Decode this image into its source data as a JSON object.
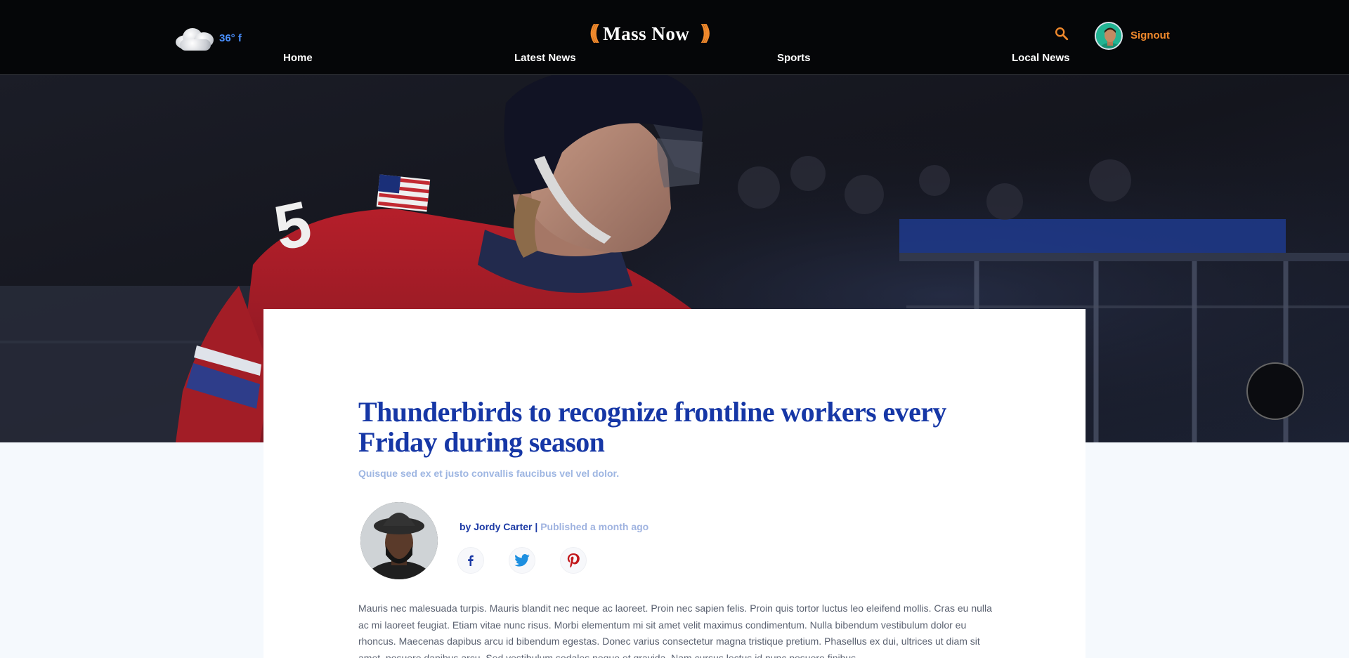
{
  "header": {
    "weather": {
      "icon": "cloud-icon",
      "temperature": "36° f"
    },
    "logo": {
      "text": "Mass Now",
      "left_waves": "(((",
      "right_waves": ")))"
    },
    "search": {
      "icon": "search-icon"
    },
    "user": {
      "avatar": "user-avatar",
      "signout_label": "Signout"
    },
    "nav": [
      {
        "label": "Home"
      },
      {
        "label": "Latest News"
      },
      {
        "label": "Sports"
      },
      {
        "label": "Local News"
      }
    ]
  },
  "hero": {
    "image": "hockey-player-photo"
  },
  "article": {
    "title": "Thunderbirds to recognize frontline workers every Friday during season",
    "subtitle": "Quisque sed ex et justo convallis faucibus vel vel dolor.",
    "author_prefix": "by",
    "author_name": "Jordy Carter",
    "separator": "|",
    "published": "Published a month ago",
    "share": [
      {
        "network": "facebook",
        "icon": "facebook-icon",
        "color": "#1c3aa5"
      },
      {
        "network": "twitter",
        "icon": "twitter-icon",
        "color": "#1d8fe0"
      },
      {
        "network": "pinterest",
        "icon": "pinterest-icon",
        "color": "#c2181b"
      }
    ],
    "body": "Mauris nec malesuada turpis. Mauris blandit nec neque ac laoreet. Proin nec sapien felis. Proin quis tortor luctus leo eleifend mollis. Cras eu nulla ac mi laoreet feugiat. Etiam vitae nunc risus. Morbi elementum mi sit amet velit maximus condimentum. Nulla bibendum vestibulum dolor eu rhoncus. Maecenas dapibus arcu id bibendum egestas. Donec varius consectetur magna tristique pretium. Phasellus ex dui, ultrices ut diam sit amet, posuere dapibus arcu. Sed vestibulum sodales neque et gravida. Nam cursus lectus id nunc posuere finibus."
  },
  "colors": {
    "accent_orange": "#f0892c",
    "headline_blue": "#1637a6",
    "weather_blue": "#4a90ff"
  }
}
